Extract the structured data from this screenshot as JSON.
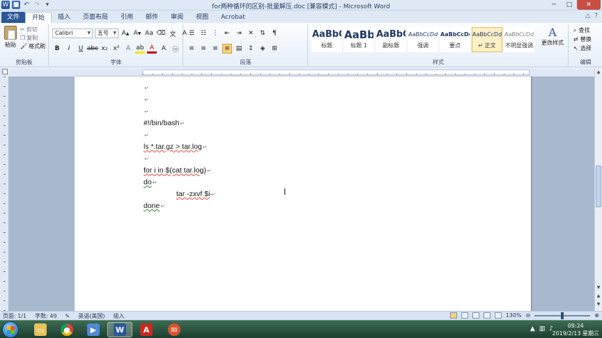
{
  "window": {
    "title": "for两种循环的区别-批量解压.doc [兼容模式] - Microsoft Word",
    "controls": {
      "minimize": "─",
      "maximize": "□",
      "close": "✕"
    }
  },
  "tabs": [
    "文件",
    "开始",
    "插入",
    "页面布局",
    "引用",
    "邮件",
    "审阅",
    "视图",
    "Acrobat"
  ],
  "active_tab": "开始",
  "ribbon": {
    "clipboard": {
      "paste": "粘贴",
      "cut": "剪切",
      "copy": "复制",
      "format_painter": "格式刷",
      "label": "剪贴板"
    },
    "font": {
      "name": "Calibri",
      "size": "五号",
      "label": "字体"
    },
    "paragraph": {
      "label": "段落"
    },
    "styles": {
      "label": "样式",
      "items": [
        {
          "preview": "AaBbC",
          "name": "标题"
        },
        {
          "preview": "AaBb",
          "name": "标题 1"
        },
        {
          "preview": "AaBbC",
          "name": "副标题"
        },
        {
          "preview": "AaBbCcDd",
          "name": "强调"
        },
        {
          "preview": "AaBbCcDd",
          "name": "要点"
        },
        {
          "preview": "AaBbCcDd",
          "name": "↵ 正文"
        },
        {
          "preview": "AaBbCcDd",
          "name": "不明显强调"
        }
      ],
      "active_index": 5,
      "change_styles": "更改样式"
    },
    "editing": {
      "label": "编辑",
      "find": "查找",
      "replace": "替换",
      "select": "选择"
    }
  },
  "document": {
    "lines": [
      {
        "text": "",
        "mark": "↵"
      },
      {
        "text": "",
        "mark": "↵"
      },
      {
        "text": "",
        "mark": "↵"
      },
      {
        "text": "#!/bin/bash",
        "mark": "↵"
      },
      {
        "text": "",
        "mark": "↵"
      },
      {
        "text": "ls *.tar.gz > tar.log",
        "mark": "↵"
      },
      {
        "text": "",
        "mark": "↵"
      },
      {
        "text": "for i in $(cat tar.log)",
        "mark": "↵"
      },
      {
        "text": "do",
        "mark": "↵"
      },
      {
        "text": "tar -zxvf $i",
        "mark": "↵"
      },
      {
        "text": "done",
        "mark": "↵"
      }
    ]
  },
  "statusbar": {
    "page": "页面: 1/1",
    "words": "字数: 49",
    "language": "英语(美国)",
    "mode": "插入",
    "zoom": "130%"
  },
  "taskbar": {
    "time": "09:24",
    "date": "2019/2/13 星期三"
  }
}
